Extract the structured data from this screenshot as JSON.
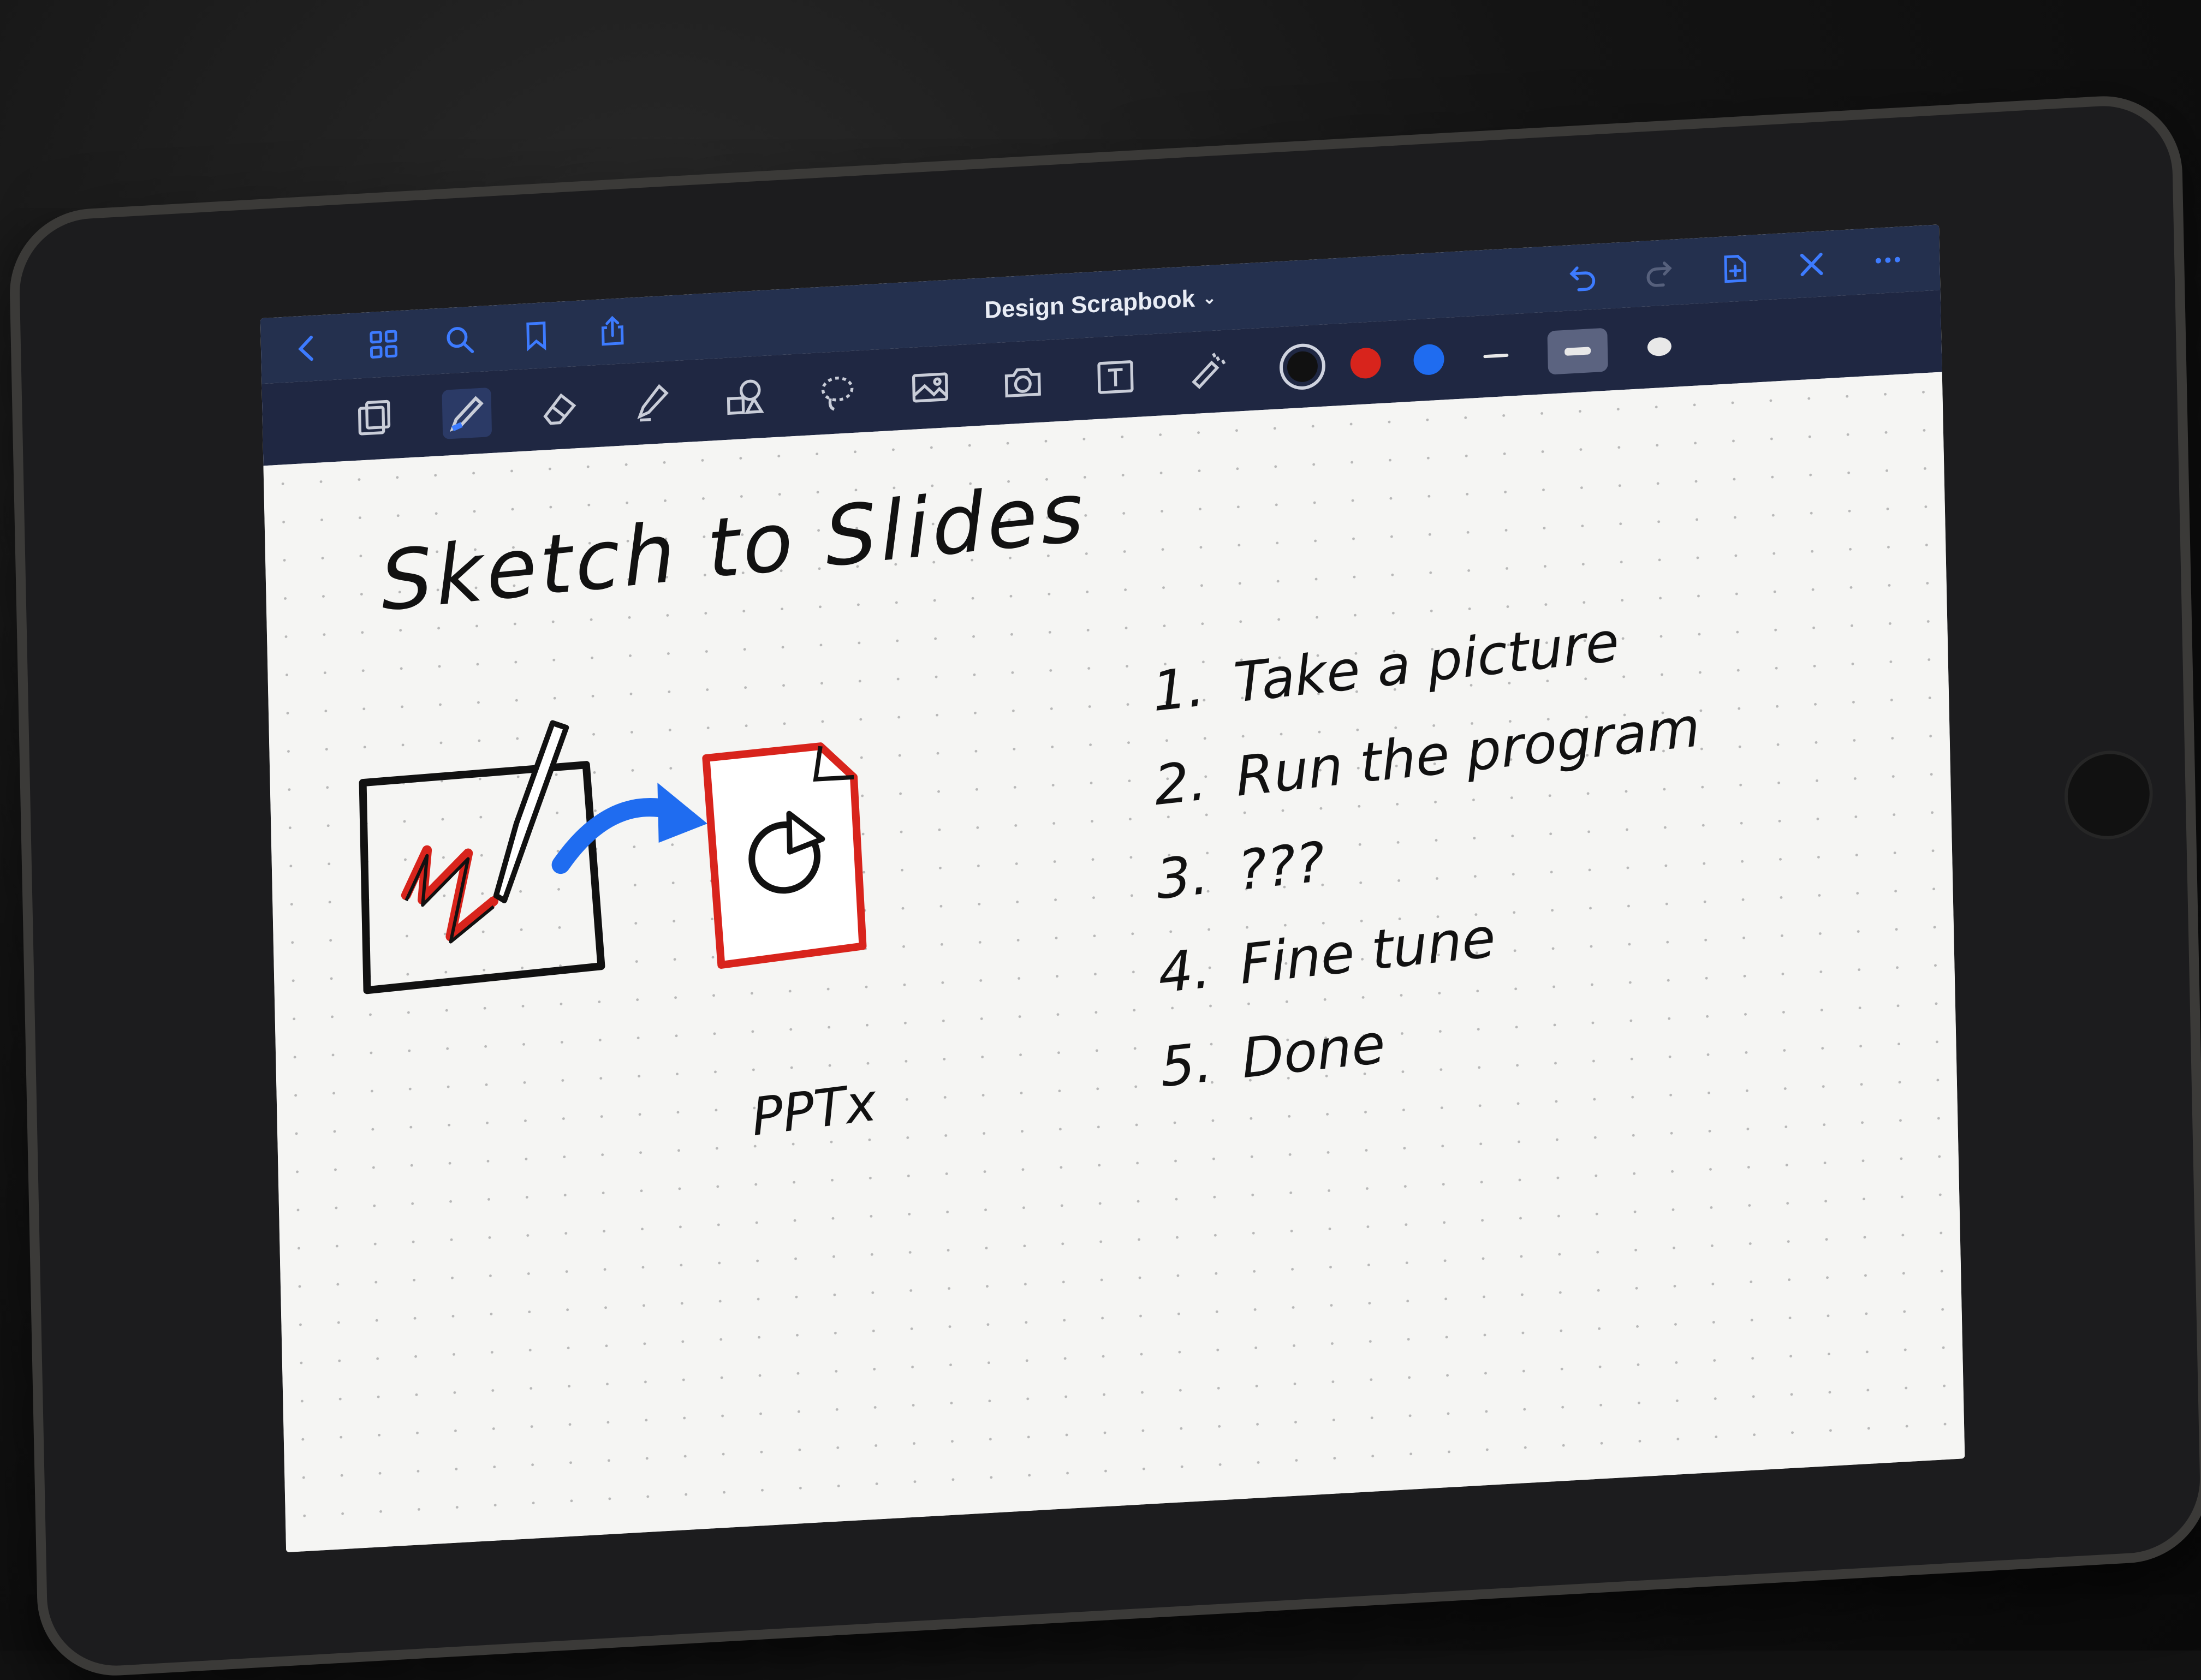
{
  "nav": {
    "title": "Design Scrapbook",
    "left_icons": [
      "back-chevron-icon",
      "grid-icon",
      "search-icon",
      "bookmark-icon",
      "share-icon"
    ],
    "right_icons": [
      "undo-icon",
      "redo-icon",
      "add-page-icon",
      "close-icon",
      "more-icon"
    ]
  },
  "toolbar": {
    "tools": [
      "page-layout-icon",
      "pen-icon",
      "eraser-icon",
      "highlighter-icon",
      "shapes-icon",
      "lasso-icon",
      "image-icon",
      "camera-icon",
      "text-icon",
      "laser-pointer-icon"
    ],
    "active_tool": "pen-icon",
    "colors": [
      "#111111",
      "#d8241c",
      "#1f6cf0"
    ],
    "selected_color": "#111111"
  },
  "note": {
    "heading": "Sketch to Slides",
    "file_label": "PPTx",
    "steps": [
      {
        "num": "1.",
        "text": "Take a picture"
      },
      {
        "num": "2.",
        "text": "Run the program"
      },
      {
        "num": "3.",
        "text": "???"
      },
      {
        "num": "4.",
        "text": "Fine tune"
      },
      {
        "num": "5.",
        "text": "Done"
      }
    ]
  }
}
